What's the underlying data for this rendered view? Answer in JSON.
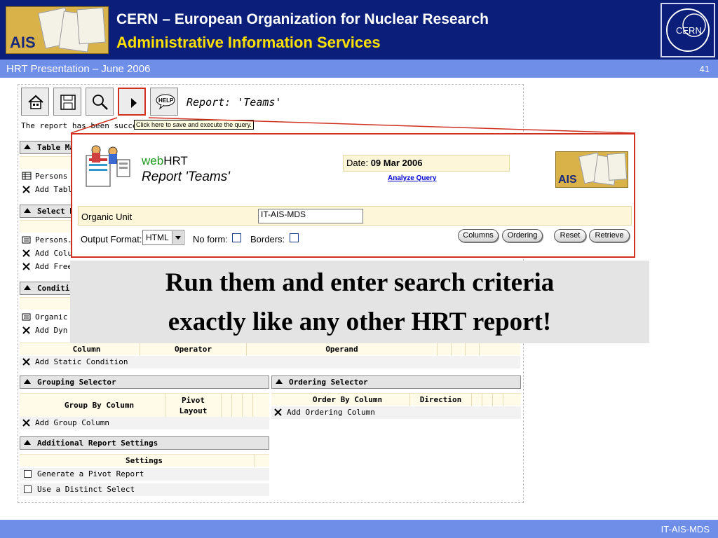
{
  "header": {
    "org_title": "CERN – European Organization for Nuclear Research",
    "org_subtitle": "Administrative Information Services",
    "ais_logo_text": "AIS",
    "cern_logo_text": "CERN"
  },
  "sub_bar": {
    "presentation": "HRT Presentation – June 2006",
    "slide_number": "41"
  },
  "footer": {
    "label": "IT-AIS-MDS"
  },
  "app": {
    "toolbar": {
      "buttons": [
        {
          "name": "home",
          "icon": "house-icon"
        },
        {
          "name": "save",
          "icon": "floppy-disk-icon"
        },
        {
          "name": "search",
          "icon": "magnifier-icon"
        },
        {
          "name": "run",
          "icon": "play-icon"
        },
        {
          "name": "help",
          "icon": "help-bubble-icon",
          "text": "HELP"
        }
      ],
      "report_title": "Report: 'Teams'",
      "tooltip": "Click here to save and execute the query."
    },
    "status_message": "The report has been succe",
    "table_section": {
      "title": "Table Ma",
      "rows": [
        {
          "icon": "table-icon",
          "label": "Persons ("
        },
        {
          "icon": "tools-icon",
          "label": "Add Table"
        }
      ]
    },
    "select_section": {
      "title": "Select Bu",
      "rows": [
        {
          "icon": "form-icon",
          "label": "Persons.F"
        },
        {
          "icon": "tools-icon",
          "label": "Add Colu"
        },
        {
          "icon": "tools-icon",
          "label": "Add Free"
        }
      ]
    },
    "condition_section": {
      "title": "Conditio",
      "rows": [
        {
          "icon": "form-icon",
          "label": "Organic"
        },
        {
          "icon": "tools-icon",
          "label": "Add Dyn"
        }
      ],
      "columns": [
        "Column",
        "Operator",
        "Operand"
      ],
      "add_static": "Add Static Condition"
    },
    "grouping": {
      "title": "Grouping Selector",
      "columns": [
        "Group By Column",
        "Pivot Layout"
      ],
      "add_label": "Add Group Column"
    },
    "ordering": {
      "title": "Ordering Selector",
      "columns": [
        "Order By Column",
        "Direction"
      ],
      "add_label": "Add Ordering Column"
    },
    "additional": {
      "title": "Additional Report Settings",
      "settings_header": "Settings",
      "options": [
        {
          "label": "Generate a Pivot Report",
          "checked": false
        },
        {
          "label": "Use a Distinct Select",
          "checked": false
        }
      ]
    }
  },
  "inset": {
    "web": "web",
    "hrt": "HRT",
    "report_title": "Report 'Teams'",
    "date_label": "Date:",
    "date_value": "09 Mar 2006",
    "analyze_link": "Analyze Query",
    "ais_logo_text": "AIS",
    "org_unit_label": "Organic Unit",
    "org_unit_value": "IT-AIS-MDS",
    "output_format_label": "Output Format:",
    "output_format_value": "HTML",
    "no_form_label": "No form:",
    "borders_label": "Borders:",
    "no_form_checked": false,
    "borders_checked": false,
    "buttons": {
      "columns": "Columns",
      "ordering": "Ordering",
      "reset": "Reset",
      "retrieve": "Retrieve"
    }
  },
  "callout": {
    "line1": "Run them and enter search criteria",
    "line2": "exactly like any other HRT report!"
  },
  "colors": {
    "header_bg": "#0b1f7a",
    "bar_bg": "#6e8ee8",
    "subtitle": "#ffe000",
    "highlight": "#d03020",
    "row_tint": "#fffbe8"
  }
}
